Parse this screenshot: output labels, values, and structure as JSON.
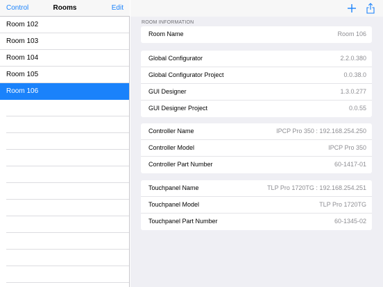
{
  "master": {
    "back_label": "Control",
    "title": "Rooms",
    "edit_label": "Edit",
    "rooms": [
      "Room 102",
      "Room 103",
      "Room 104",
      "Room 105",
      "Room 106"
    ],
    "selected_room": "Room 106"
  },
  "detail": {
    "add_icon": "plus-icon",
    "share_icon": "share-icon",
    "section_header": "ROOM INFORMATION",
    "room": {
      "label": "Room Name",
      "value": "Room 106"
    },
    "software": [
      {
        "label": "Global Configurator",
        "value": "2.2.0.380"
      },
      {
        "label": "Global Configurator Project",
        "value": "0.0.38.0"
      },
      {
        "label": "GUI Designer",
        "value": "1.3.0.277"
      },
      {
        "label": "GUI Designer Project",
        "value": "0.0.55"
      }
    ],
    "controller": [
      {
        "label": "Controller Name",
        "value": "IPCP Pro 350 : 192.168.254.250"
      },
      {
        "label": "Controller Model",
        "value": "IPCP Pro 350"
      },
      {
        "label": "Controller Part Number",
        "value": "60-1417-01"
      }
    ],
    "touchpanel": [
      {
        "label": "Touchpanel Name",
        "value": "TLP Pro 1720TG : 192.168.254.251"
      },
      {
        "label": "Touchpanel Model",
        "value": "TLP Pro 1720TG"
      },
      {
        "label": "Touchpanel Part Number",
        "value": "60-1345-02"
      }
    ]
  },
  "colors": {
    "accent": "#1a82fb",
    "detail_background": "#efeff4",
    "value_text": "#8e8e93"
  }
}
